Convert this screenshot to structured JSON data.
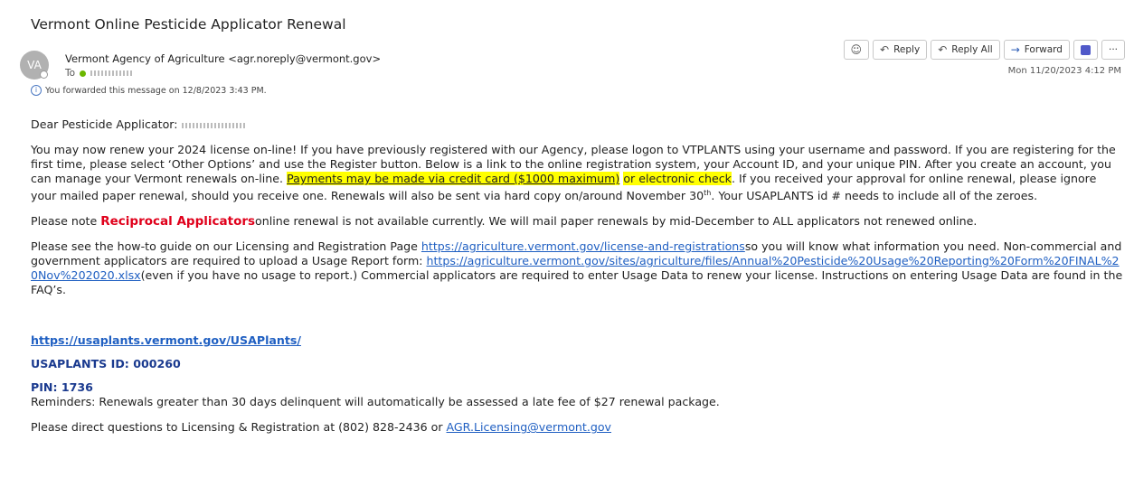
{
  "email": {
    "subject": "Vermont Online Pesticide Applicator Renewal",
    "avatar_initials": "VA",
    "sender": "Vermont Agency of Agriculture <agr.noreply@vermont.gov>",
    "to_label": "To",
    "forwarded_note": "You forwarded this message on 12/8/2023 3:43 PM.",
    "date": "Mon 11/20/2023 4:12 PM"
  },
  "toolbar": {
    "emoji_icon": "smiley-icon",
    "reply": "Reply",
    "reply_all": "Reply All",
    "forward": "Forward",
    "teams_icon": "teams-icon",
    "more": "···"
  },
  "body": {
    "greeting": "Dear Pesticide Applicator:",
    "p1_a": "You may now renew your 2024 license on-line! If you have previously registered with our Agency, please logon to VTPLANTS using your username and password. If you are registering for the first time, please select ‘Other Options’ and use the Register button. Below is a link to the online registration system, your Account ID, and your unique PIN. After you create an account, you can manage your Vermont renewals on-line.",
    "p1_hl1": "Payments may be made via credit card ($1000 maximum)",
    "p1_hl2": "or electronic check",
    "p1_b": ". If you received your approval for online renewal, please ignore your mailed paper renewal, should you receive one. Renewals will also be sent via hard copy on/around November 30",
    "p1_sup": "th",
    "p1_c": ". Your USAPLANTS id # needs to include all of the zeroes.",
    "p2_a": "Please note ",
    "p2_red": "Reciprocal Applicators",
    "p2_b": "online renewal is not available currently. We will mail paper renewals by mid-December to ALL applicators not renewed online.",
    "p3_a": "Please see the how-to guide on our Licensing and Registration Page ",
    "p3_link1": "https://agriculture.vermont.gov/license-and-registrations",
    "p3_b": "so you will know what information you need. Non-commercial and government applicators are required to upload a Usage Report form: ",
    "p3_link2": "https://agriculture.vermont.gov/sites/agriculture/files/Annual%20Pesticide%20Usage%20Reporting%20Form%20FINAL%20Nov%202020.xlsx",
    "p3_c": "(even if you have no usage to report.) Commercial applicators are required to enter Usage Data to renew your license. Instructions on entering Usage Data are found in the FAQ’s.",
    "url": "https://usaplants.vermont.gov/USAPlants/",
    "usaplants_id": "USAPLANTS ID: 000260",
    "pin": "PIN: 1736",
    "reminder": "Reminders: Renewals greater than 30 days delinquent will automatically be assessed a late fee of $27 renewal package.",
    "contact_a": "Please direct questions to Licensing & Registration at (802) 828-2436 or ",
    "contact_email": "AGR.Licensing@vermont.gov"
  }
}
